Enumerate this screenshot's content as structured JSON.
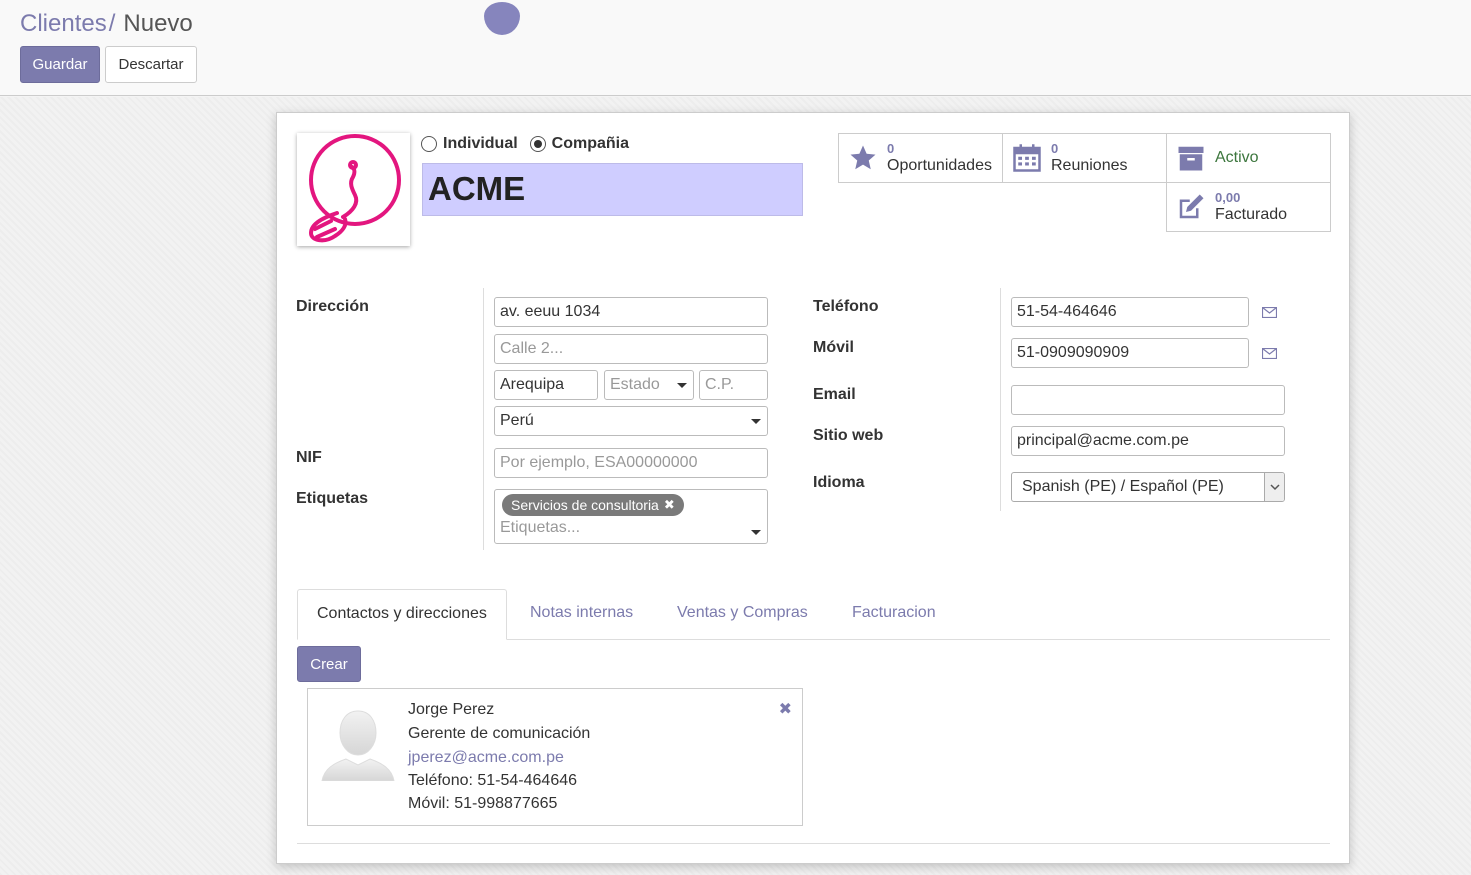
{
  "breadcrumb": {
    "parent": "Clientes",
    "separator": "/",
    "current": "Nuevo"
  },
  "toolbar": {
    "save_label": "Guardar",
    "discard_label": "Descartar"
  },
  "partner": {
    "type_options": [
      {
        "label": "Individual",
        "checked": false
      },
      {
        "label": "Compañia",
        "checked": true
      }
    ],
    "name": "ACME",
    "logo_color": "#e3167f"
  },
  "stats": {
    "opportunities": {
      "count": "0",
      "label": "Oportunidades",
      "icon": "star-icon"
    },
    "meetings": {
      "count": "0",
      "label": "Reuniones",
      "icon": "calendar-icon"
    },
    "active": {
      "label": "Activo",
      "icon": "archive-icon",
      "color": "#3c763d"
    },
    "invoiced": {
      "count": "0,00",
      "label": "Facturado",
      "icon": "edit-icon"
    }
  },
  "address": {
    "label": "Dirección",
    "street": "av. eeuu 1034",
    "street2_placeholder": "Calle 2...",
    "city": "Arequipa",
    "state_placeholder": "Estado",
    "zip_placeholder": "C.P.",
    "country": "Perú"
  },
  "nif": {
    "label": "NIF",
    "placeholder": "Por ejemplo, ESA00000000"
  },
  "tags": {
    "label": "Etiquetas",
    "items": [
      "Servicios de consultoria"
    ],
    "placeholder": "Etiquetas..."
  },
  "contact_info": {
    "phone": {
      "label": "Teléfono",
      "value": "51-54-464646"
    },
    "mobile": {
      "label": "Móvil",
      "value": "51-0909090909"
    },
    "email": {
      "label": "Email",
      "value": ""
    },
    "website": {
      "label": "Sitio web",
      "value": "principal@acme.com.pe"
    },
    "language": {
      "label": "Idioma",
      "value": "Spanish (PE) / Español (PE)"
    }
  },
  "tabs": [
    "Contactos y direcciones",
    "Notas internas",
    "Ventas y Compras",
    "Facturacion"
  ],
  "create_label": "Crear",
  "contacts": [
    {
      "name": "Jorge Perez",
      "function": "Gerente de comunicación",
      "email": "jperez@acme.com.pe",
      "phone": "Teléfono: 51-54-464646",
      "mobile": "Móvil: 51-998877665"
    }
  ],
  "colors": {
    "brand": "#7c7bad",
    "name_highlight": "#cfcdff"
  }
}
